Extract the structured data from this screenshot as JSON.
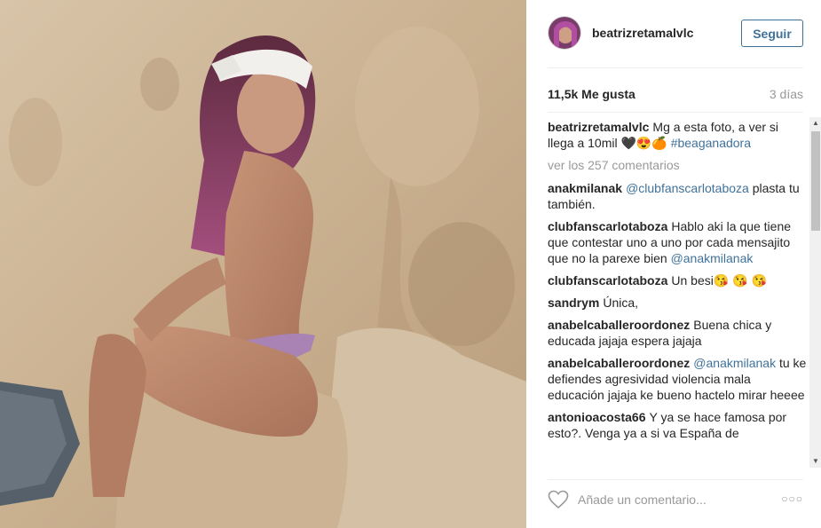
{
  "post": {
    "author": "beatrizretamalvlc",
    "follow_label": "Seguir",
    "likes": "11,5k Me gusta",
    "age": "3 días",
    "view_all_comments": "ver los 257 comentarios",
    "add_comment_placeholder": "Añade un comentario...",
    "more_options": "○○○"
  },
  "comments": [
    {
      "user": "beatrizretamalvlc",
      "text": "Mg a esta foto, a ver si llega a 10mil 🖤😍🍊",
      "link": "#beaganadora"
    },
    {
      "user": "anakmilanak",
      "link": "@clubfanscarlotaboza",
      "text": "plasta tu también."
    },
    {
      "user": "clubfanscarlotaboza",
      "text": "Hablo aki la que tiene que contestar uno a uno por cada mensajito que no la parexe bien",
      "link": "@anakmilanak"
    },
    {
      "user": "clubfanscarlotaboza",
      "text": "Un besi😘 😘 😘"
    },
    {
      "user": "sandrym",
      "text": "Única,"
    },
    {
      "user": "anabelcaballeroordonez",
      "text": "Buena chica y educada jajaja espera jajaja"
    },
    {
      "user": "anabelcaballeroordonez",
      "link": "@anakmilanak",
      "text": "tu ke defiendes agresividad violencia mala educación jajaja ke bueno hactelo mirar heeee"
    },
    {
      "user": "antonioacosta66",
      "text": "Y ya se hace famosa por esto?. Venga ya a si va España de"
    }
  ],
  "colors": {
    "link": "#3f729b",
    "muted": "#999999",
    "text": "#262626"
  },
  "icons": {
    "like": "heart-outline-icon",
    "options": "more-options-icon"
  }
}
